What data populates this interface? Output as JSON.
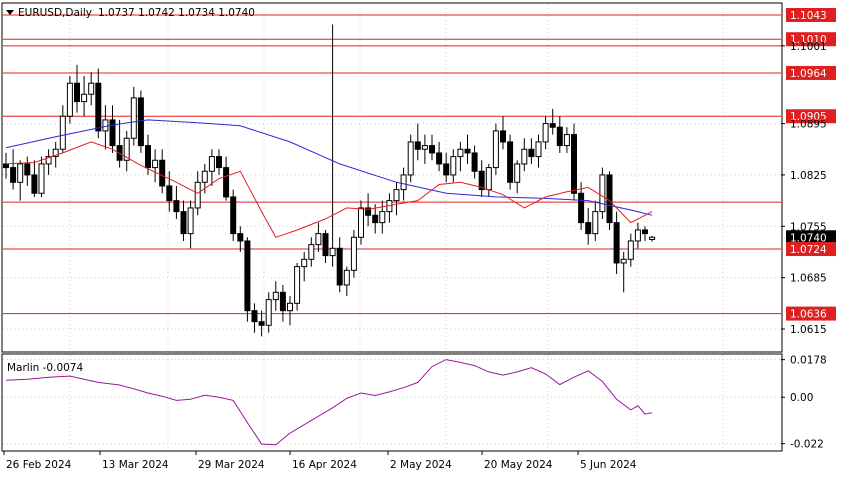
{
  "header": {
    "symbol": "EURUSD,Daily",
    "ohlc": "1.0737 1.0742 1.0734 1.0740"
  },
  "indicator": {
    "label": "Marlin -0.0074"
  },
  "colors": {
    "level": "#e02020",
    "price_tag": "#000000",
    "ma_slow": "#2a2ad8",
    "ma_fast": "#e02020",
    "oscillator": "#9a189a",
    "grid": "#c8d0e0"
  },
  "chart_data": [
    {
      "type": "candlestick",
      "title": "EURUSD,Daily",
      "ylim": [
        1.0585,
        1.1058
      ],
      "yticks": [
        "1.1043",
        "1.1010",
        "1.1001",
        "1.0964",
        "1.0905",
        "1.0895",
        "1.0825",
        "1.0755",
        "1.0740",
        "1.0724",
        "1.0685",
        "1.0636",
        "1.0615"
      ],
      "xticks": [
        "26 Feb 2024",
        "13 Mar 2024",
        "29 Mar 2024",
        "16 Apr 2024",
        "2 May 2024",
        "20 May 2024",
        "5 Jun 2024"
      ],
      "horizontal_levels": [
        1.1043,
        1.101,
        1.1001,
        1.0964,
        1.0905,
        1.0788,
        1.0724,
        1.0636
      ],
      "current_price": 1.074,
      "candles": [
        [
          1.084,
          1.0855,
          1.082,
          1.0835
        ],
        [
          1.0835,
          1.086,
          1.0805,
          1.0815
        ],
        [
          1.0815,
          1.0845,
          1.079,
          1.084
        ],
        [
          1.084,
          1.085,
          1.081,
          1.0825
        ],
        [
          1.0825,
          1.0845,
          1.0795,
          1.08
        ],
        [
          1.08,
          1.085,
          1.0795,
          1.084
        ],
        [
          1.084,
          1.086,
          1.0825,
          1.085
        ],
        [
          1.085,
          1.087,
          1.0835,
          1.086
        ],
        [
          1.086,
          1.092,
          1.0855,
          1.0905
        ],
        [
          1.0905,
          1.096,
          1.0895,
          1.095
        ],
        [
          1.095,
          1.0975,
          1.091,
          1.0925
        ],
        [
          1.0925,
          1.096,
          1.0905,
          1.0935
        ],
        [
          1.0935,
          1.0965,
          1.092,
          1.095
        ],
        [
          1.095,
          1.097,
          1.0875,
          1.0885
        ],
        [
          1.0885,
          1.092,
          1.086,
          1.09
        ],
        [
          1.09,
          1.092,
          1.0855,
          1.0865
        ],
        [
          1.0865,
          1.09,
          1.0835,
          1.0845
        ],
        [
          1.0845,
          1.0885,
          1.083,
          1.0875
        ],
        [
          1.0875,
          1.0945,
          1.0865,
          1.093
        ],
        [
          1.093,
          1.094,
          1.0855,
          1.0865
        ],
        [
          1.0865,
          1.088,
          1.0825,
          1.0835
        ],
        [
          1.0835,
          1.086,
          1.0815,
          1.0845
        ],
        [
          1.0845,
          1.086,
          1.08,
          1.081
        ],
        [
          1.081,
          1.083,
          1.0775,
          1.079
        ],
        [
          1.079,
          1.081,
          1.0765,
          1.0775
        ],
        [
          1.0775,
          1.079,
          1.0735,
          1.0745
        ],
        [
          1.0745,
          1.079,
          1.0725,
          1.078
        ],
        [
          1.078,
          1.083,
          1.077,
          1.0815
        ],
        [
          1.0815,
          1.084,
          1.08,
          1.083
        ],
        [
          1.083,
          1.086,
          1.081,
          1.085
        ],
        [
          1.085,
          1.086,
          1.0825,
          1.0835
        ],
        [
          1.0835,
          1.085,
          1.079,
          1.0795
        ],
        [
          1.0795,
          1.0805,
          1.0735,
          1.0745
        ],
        [
          1.0745,
          1.0755,
          1.072,
          1.0735
        ],
        [
          1.0735,
          1.074,
          1.0625,
          1.064
        ],
        [
          1.064,
          1.065,
          1.061,
          1.0625
        ],
        [
          1.0625,
          1.064,
          1.0605,
          1.062
        ],
        [
          1.062,
          1.0665,
          1.061,
          1.0655
        ],
        [
          1.0655,
          1.068,
          1.064,
          1.0665
        ],
        [
          1.0665,
          1.0675,
          1.0625,
          1.064
        ],
        [
          1.064,
          1.066,
          1.062,
          1.065
        ],
        [
          1.065,
          1.0705,
          1.064,
          1.07
        ],
        [
          1.07,
          1.072,
          1.068,
          1.071
        ],
        [
          1.071,
          1.074,
          1.07,
          1.073
        ],
        [
          1.073,
          1.076,
          1.072,
          1.0745
        ],
        [
          1.0745,
          1.075,
          1.0705,
          1.0715
        ],
        [
          1.0715,
          1.103,
          1.07,
          1.0725
        ],
        [
          1.0725,
          1.074,
          1.0665,
          1.0675
        ],
        [
          1.0675,
          1.07,
          1.066,
          1.0695
        ],
        [
          1.0695,
          1.075,
          1.0685,
          1.074
        ],
        [
          1.074,
          1.079,
          1.073,
          1.078
        ],
        [
          1.078,
          1.08,
          1.0755,
          1.077
        ],
        [
          1.077,
          1.0785,
          1.0745,
          1.076
        ],
        [
          1.076,
          1.079,
          1.0745,
          1.0775
        ],
        [
          1.0775,
          1.08,
          1.076,
          1.079
        ],
        [
          1.079,
          1.0815,
          1.077,
          1.0805
        ],
        [
          1.0805,
          1.0835,
          1.079,
          1.0825
        ],
        [
          1.0825,
          1.088,
          1.0815,
          1.087
        ],
        [
          1.087,
          1.0895,
          1.0845,
          1.086
        ],
        [
          1.086,
          1.088,
          1.084,
          1.0865
        ],
        [
          1.0865,
          1.088,
          1.0845,
          1.0855
        ],
        [
          1.0855,
          1.087,
          1.083,
          1.084
        ],
        [
          1.084,
          1.0855,
          1.0815,
          1.0825
        ],
        [
          1.0825,
          1.086,
          1.0815,
          1.085
        ],
        [
          1.085,
          1.087,
          1.083,
          1.086
        ],
        [
          1.086,
          1.088,
          1.084,
          1.0855
        ],
        [
          1.0855,
          1.0865,
          1.082,
          1.083
        ],
        [
          1.083,
          1.0845,
          1.0795,
          1.0805
        ],
        [
          1.0805,
          1.084,
          1.0795,
          1.0835
        ],
        [
          1.0835,
          1.0895,
          1.0825,
          1.0885
        ],
        [
          1.0885,
          1.0905,
          1.086,
          1.087
        ],
        [
          1.087,
          1.088,
          1.0805,
          1.0815
        ],
        [
          1.0815,
          1.0845,
          1.08,
          1.084
        ],
        [
          1.084,
          1.0875,
          1.083,
          1.086
        ],
        [
          1.086,
          1.0875,
          1.084,
          1.085
        ],
        [
          1.085,
          1.088,
          1.0835,
          1.087
        ],
        [
          1.087,
          1.0905,
          1.086,
          1.0895
        ],
        [
          1.0895,
          1.0915,
          1.088,
          1.089
        ],
        [
          1.089,
          1.0905,
          1.0855,
          1.0865
        ],
        [
          1.0865,
          1.089,
          1.0855,
          1.088
        ],
        [
          1.088,
          1.0895,
          1.079,
          1.08
        ],
        [
          1.08,
          1.0815,
          1.075,
          1.076
        ],
        [
          1.076,
          1.078,
          1.073,
          1.0745
        ],
        [
          1.0745,
          1.079,
          1.0735,
          1.0775
        ],
        [
          1.0775,
          1.0835,
          1.0765,
          1.0825
        ],
        [
          1.0825,
          1.083,
          1.075,
          1.076
        ],
        [
          1.076,
          1.0775,
          1.069,
          1.0705
        ],
        [
          1.0705,
          1.072,
          1.0665,
          1.071
        ],
        [
          1.071,
          1.0745,
          1.07,
          1.0735
        ],
        [
          1.0735,
          1.076,
          1.0725,
          1.075
        ],
        [
          1.075,
          1.0755,
          1.0735,
          1.0745
        ],
        [
          1.0737,
          1.0742,
          1.0734,
          1.074
        ]
      ],
      "ma_slow": [
        [
          0,
          1.0862
        ],
        [
          7,
          1.0877
        ],
        [
          15,
          1.0893
        ],
        [
          20,
          1.09
        ],
        [
          27,
          1.0896
        ],
        [
          33,
          1.0892
        ],
        [
          40,
          1.087
        ],
        [
          47,
          1.084
        ],
        [
          55,
          1.0815
        ],
        [
          62,
          1.08
        ],
        [
          69,
          1.0795
        ],
        [
          76,
          1.0793
        ],
        [
          82,
          1.079
        ],
        [
          89,
          1.0775
        ],
        [
          91,
          1.077
        ]
      ],
      "ma_fast": [
        [
          0,
          1.084
        ],
        [
          4,
          1.0842
        ],
        [
          8,
          1.0855
        ],
        [
          12,
          1.087
        ],
        [
          15,
          1.086
        ],
        [
          19,
          1.0838
        ],
        [
          24,
          1.0815
        ],
        [
          27,
          1.08
        ],
        [
          30,
          1.082
        ],
        [
          33,
          1.083
        ],
        [
          36,
          1.0775
        ],
        [
          38,
          1.074
        ],
        [
          41,
          1.075
        ],
        [
          45,
          1.0765
        ],
        [
          48,
          1.078
        ],
        [
          51,
          1.0778
        ],
        [
          55,
          1.0785
        ],
        [
          58,
          1.079
        ],
        [
          61,
          1.0812
        ],
        [
          64,
          1.0815
        ],
        [
          67,
          1.0808
        ],
        [
          70,
          1.0798
        ],
        [
          73,
          1.078
        ],
        [
          76,
          1.0795
        ],
        [
          79,
          1.0802
        ],
        [
          82,
          1.0808
        ],
        [
          85,
          1.079
        ],
        [
          88,
          1.076
        ],
        [
          90,
          1.077
        ],
        [
          91,
          1.0775
        ]
      ]
    },
    {
      "type": "line",
      "title": "Marlin -0.0074",
      "ylim": [
        -0.025,
        0.02
      ],
      "yticks": [
        "0.0178",
        "0.00",
        "-0.022"
      ],
      "series": [
        {
          "name": "Marlin",
          "points": [
            [
              0,
              0.008
            ],
            [
              3,
              0.0085
            ],
            [
              6,
              0.0095
            ],
            [
              9,
              0.01
            ],
            [
              11,
              0.0085
            ],
            [
              13,
              0.007
            ],
            [
              16,
              0.0058
            ],
            [
              18,
              0.004
            ],
            [
              20,
              0.002
            ],
            [
              22,
              0.0005
            ],
            [
              24,
              -0.0015
            ],
            [
              26,
              -0.001
            ],
            [
              28,
              0.001
            ],
            [
              30,
              0.0
            ],
            [
              32,
              -0.0015
            ],
            [
              34,
              -0.012
            ],
            [
              36,
              -0.0222
            ],
            [
              38,
              -0.0225
            ],
            [
              40,
              -0.017
            ],
            [
              42,
              -0.013
            ],
            [
              44,
              -0.009
            ],
            [
              46,
              -0.005
            ],
            [
              48,
              -0.0005
            ],
            [
              50,
              0.002
            ],
            [
              52,
              0.0008
            ],
            [
              54,
              0.0025
            ],
            [
              56,
              0.0045
            ],
            [
              58,
              0.007
            ],
            [
              60,
              0.0145
            ],
            [
              62,
              0.0178
            ],
            [
              64,
              0.0165
            ],
            [
              66,
              0.015
            ],
            [
              68,
              0.012
            ],
            [
              70,
              0.0105
            ],
            [
              72,
              0.012
            ],
            [
              74,
              0.014
            ],
            [
              76,
              0.011
            ],
            [
              78,
              0.006
            ],
            [
              80,
              0.0095
            ],
            [
              82,
              0.0125
            ],
            [
              84,
              0.0075
            ],
            [
              86,
              -0.001
            ],
            [
              88,
              -0.006
            ],
            [
              89,
              -0.004
            ],
            [
              90,
              -0.008
            ],
            [
              91,
              -0.0074
            ]
          ]
        }
      ]
    }
  ]
}
